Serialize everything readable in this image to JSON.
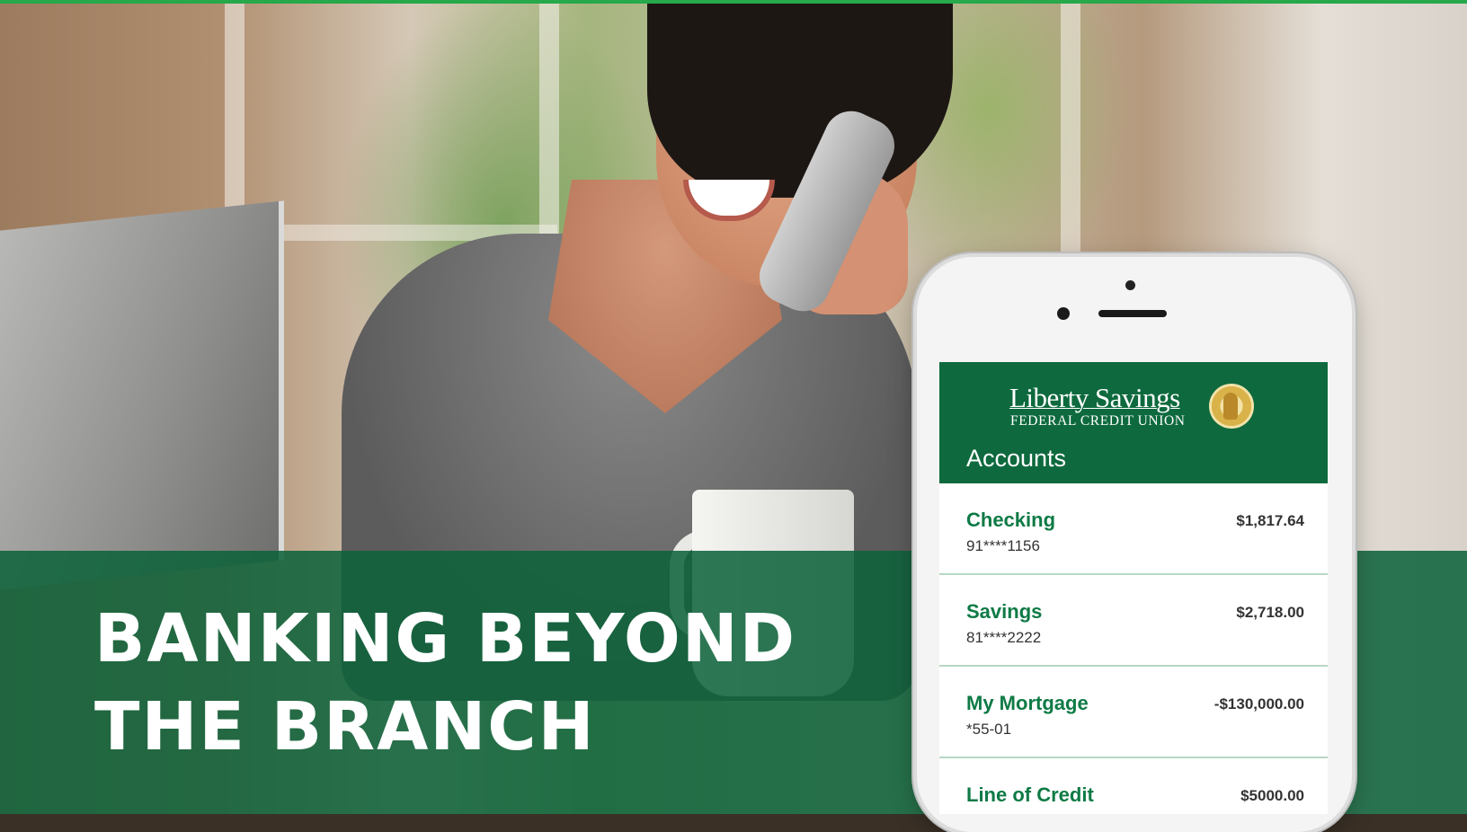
{
  "headline": {
    "line1": "BANKING BEYOND",
    "line2": "THE BRANCH"
  },
  "app": {
    "brand_name": "Liberty Savings",
    "brand_sub": "FEDERAL CREDIT UNION",
    "screen_title": "Accounts",
    "accounts": [
      {
        "name": "Checking",
        "number": "91****1156",
        "balance": "$1,817.64"
      },
      {
        "name": "Savings",
        "number": "81****2222",
        "balance": "$2,718.00"
      },
      {
        "name": "My Mortgage",
        "number": "*55-01",
        "balance": "-$130,000.00"
      },
      {
        "name": "Line of Credit",
        "number": "",
        "balance": "$5000.00"
      }
    ]
  },
  "colors": {
    "brand_green": "#0e6a3e",
    "band_green": "#0c623a",
    "account_name_green": "#0e7a45",
    "accent_line": "#27a84a"
  },
  "icons": [
    "seal-logo-icon"
  ]
}
